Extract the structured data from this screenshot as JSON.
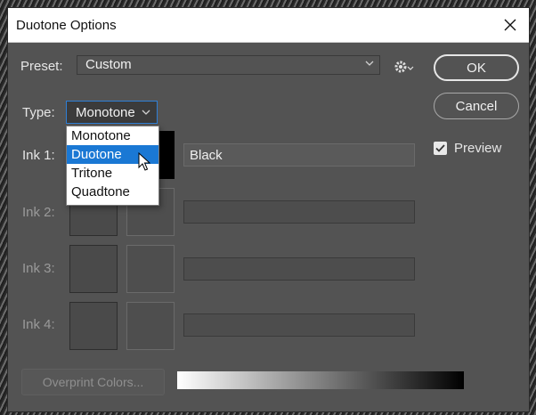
{
  "window": {
    "title": "Duotone Options"
  },
  "preset": {
    "label": "Preset:",
    "value": "Custom"
  },
  "buttons": {
    "ok": "OK",
    "cancel": "Cancel",
    "overprint": "Overprint Colors..."
  },
  "type": {
    "label": "Type:",
    "value": "Monotone",
    "options": [
      "Monotone",
      "Duotone",
      "Tritone",
      "Quadtone"
    ],
    "highlighted": "Duotone"
  },
  "inks": [
    {
      "label": "Ink 1:",
      "name": "Black",
      "enabled": true
    },
    {
      "label": "Ink 2:",
      "name": "",
      "enabled": false
    },
    {
      "label": "Ink 3:",
      "name": "",
      "enabled": false
    },
    {
      "label": "Ink 4:",
      "name": "",
      "enabled": false
    }
  ],
  "preview": {
    "label": "Preview",
    "checked": true
  },
  "colors": {
    "dialog_bg": "#535353",
    "selection": "#1a78d4",
    "focus_border": "#2f7fd6"
  },
  "icons": [
    "close-icon",
    "chevron-down-icon",
    "gear-icon",
    "checkmark-icon",
    "mouse-pointer-icon"
  ]
}
